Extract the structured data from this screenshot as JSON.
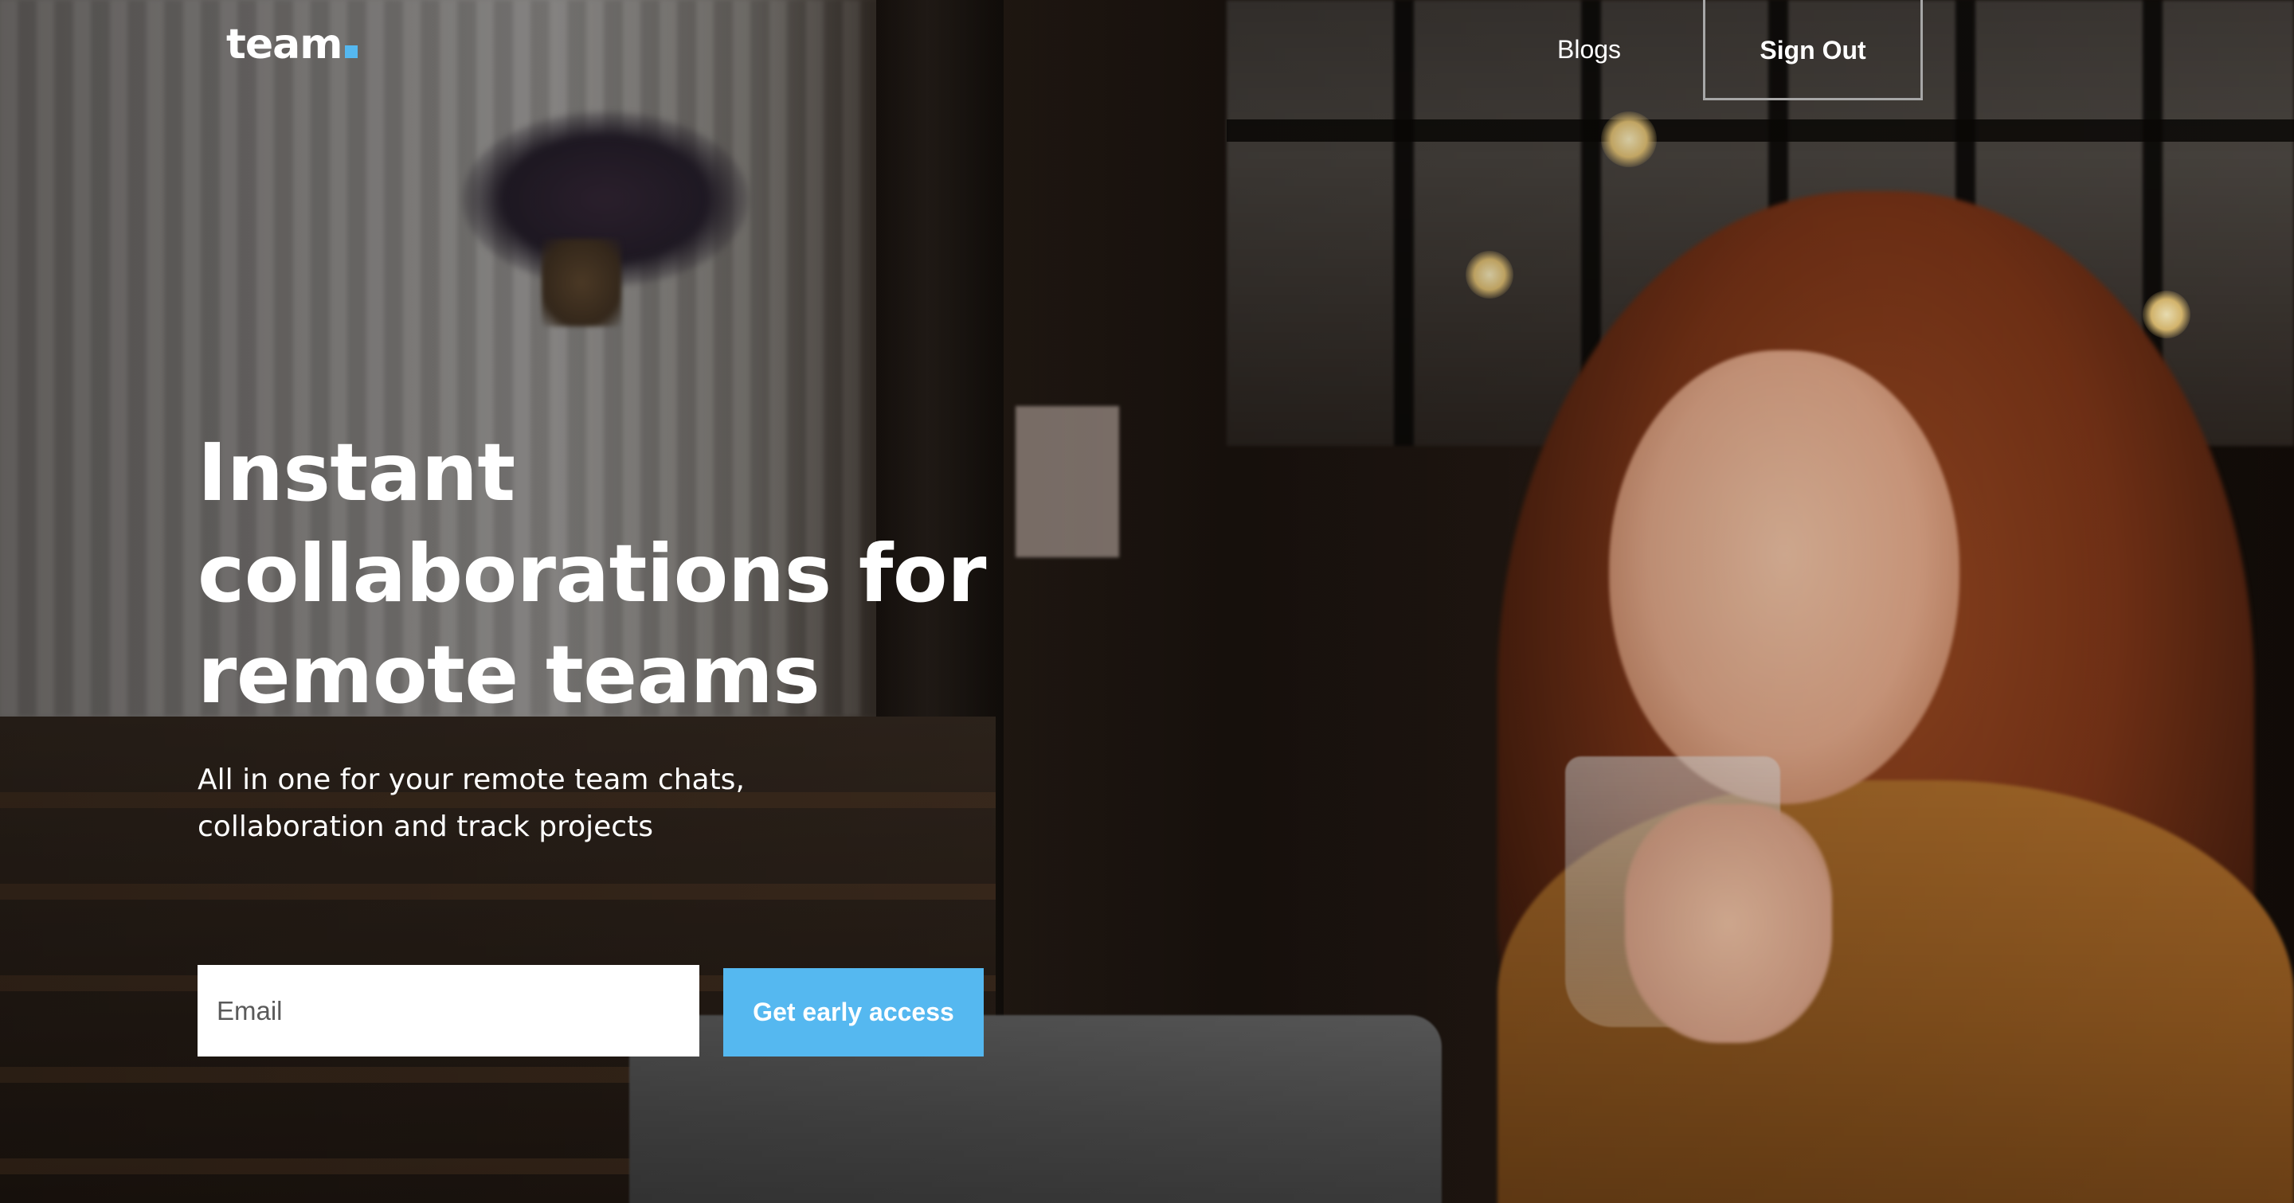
{
  "brand": {
    "name": "team",
    "accent_color": "#55b8f0"
  },
  "nav": {
    "blogs_label": "Blogs",
    "signout_label": "Sign Out"
  },
  "hero": {
    "headline_lines": [
      "Instant",
      "collaborations for",
      "remote teams"
    ],
    "subheading_lines": [
      "All in one for your remote team chats,",
      "collaboration and track projects"
    ],
    "email_placeholder": "Email",
    "email_value": "",
    "cta_label": "Get early access"
  },
  "background": {
    "image": "photo-woman-drinking-iced-coffee-in-cafe"
  }
}
